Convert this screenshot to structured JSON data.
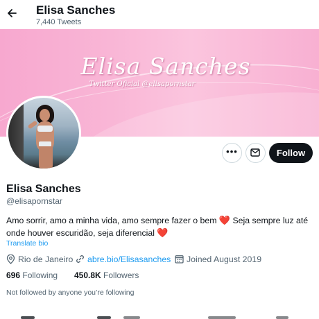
{
  "header": {
    "name": "Elisa Sanches",
    "tweet_count": "7,440 Tweets",
    "back_icon": "arrow-left-icon"
  },
  "banner": {
    "title": "Elisa Sanches",
    "subtitle": "Twitter Oficial @elisapornstar",
    "colors": [
      "#f7a8cf",
      "#fbc5de",
      "#f8b0d2"
    ]
  },
  "actions": {
    "more_icon": "more-horizontal-icon",
    "message_icon": "envelope-icon",
    "follow_label": "Follow",
    "follow_color": "#0f1419"
  },
  "profile": {
    "name": "Elisa Sanches",
    "handle": "@elisapornstar",
    "bio_part1": "Amo sorrir, amo a minha vida, amo sempre fazer o bem ",
    "bio_emoji1": "❤️",
    "bio_part2": " Seja sempre luz até onde houver escuridão, seja diferencial ",
    "bio_emoji2": "❤️",
    "translate_label": "Translate bio",
    "location": "Rio de Janeiro",
    "link": "abre.bio/Elisasanches",
    "joined": "Joined August 2019"
  },
  "stats": {
    "following_count": "696",
    "following_label": "Following",
    "followers_count": "450.8K",
    "followers_label": "Followers"
  },
  "not_followed": "Not followed by anyone you’re following",
  "accent_color": "#1d9bf0"
}
